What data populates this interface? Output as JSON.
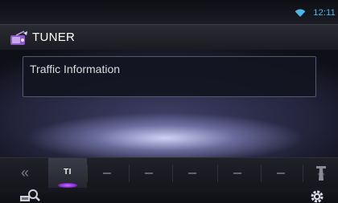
{
  "status": {
    "time": "12:11",
    "wifi_icon": "wifi-icon"
  },
  "header": {
    "title": "TUNER",
    "icon": "tuner-icon"
  },
  "info_panel": {
    "text": "Traffic Information"
  },
  "function_bar": {
    "left_icon": "double-chevron-left-icon",
    "left_symbol": "«",
    "active_key": "TI",
    "right_icon": "antenna-tower-icon",
    "accent_color": "#a03cff"
  },
  "bottom_bar": {
    "left_icon": "search-icon",
    "right_icon": "gear-icon"
  },
  "colors": {
    "clock": "#4ab7e8"
  }
}
